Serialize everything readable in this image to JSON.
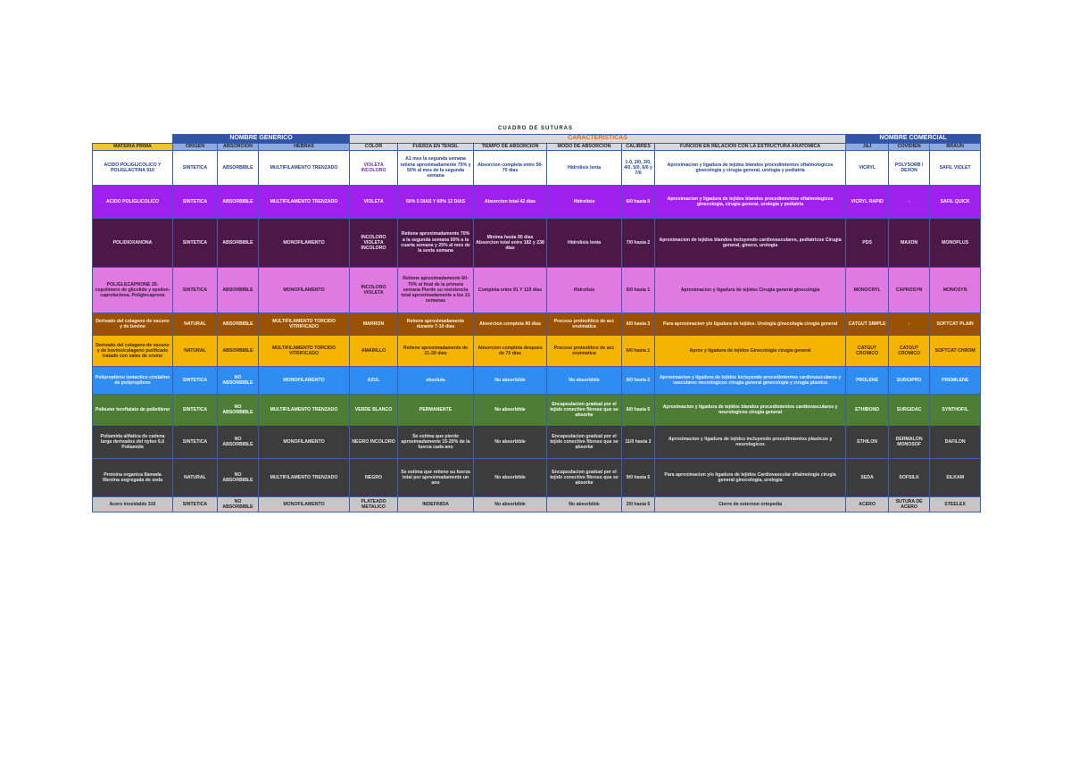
{
  "title": "CUADRO DE SUTURAS",
  "groups": {
    "generic": "NOMBRE GENERICO",
    "caract": "CARACTERISTICAS",
    "comercial": "NOMBRE COMERCIAL"
  },
  "headers": [
    "MATERIA PRIMA",
    "ORIGEN",
    "ABSORCION",
    "HEBRAS",
    "COLOR",
    "FUERZA EN TENSIL",
    "TIEMPO DE ABSORCION",
    "MODO DE ABSORCION",
    "CALIBRES",
    "FUNCION EN RELACION CON LA ESTRUCTURA ANATOMICA",
    "J&J",
    "COVIDIEN",
    "BRAUN"
  ],
  "colors": {
    "blue_header": "#3254a6",
    "orange_text": "#e26b10",
    "materia_header": "#f4c430"
  },
  "rows": [
    [
      "ACIDO POLIGLICOLICO Y POLIGLACTINA 910",
      "SINTETICA",
      "ABSORBIBLE",
      "MULTIFILAMENTO TRENZADO",
      "VIOLETA INCOLORO",
      "A1 mes la segunda semana retiene aproximadamente 75% y 50% al mes de la segunda semana",
      "Absorcion completa entre 56-70 dias",
      "Hidrolisis lenta",
      "1-0, 2/0, 3/0, 4/0, 5/0, 6/0 y 7/0",
      "Aproximacion y ligadura de tejidos blandos procedimientos oftalmologicos ginecologia y cirugia general, urologia y pediatria",
      "VICRYL",
      "POLYSORB / DEXON",
      "SAFIL VIOLET"
    ],
    [
      "ACIDO POLIGLICOLICO",
      "SINTETICA",
      "ABSORBIBLE",
      "MULTIFILAMENTO TRENZADO",
      "VIOLETA",
      "50% 5 DIAS Y 60% 12 DIAS",
      "Absorcion total 42 dias",
      "Hidrolisis",
      "6/0 hasta 0",
      "Aproximacion y ligadura de tejidos blandos procedimientos oftalmologicos ginecologia, cirugia general, urologia y pediatria",
      "VICRYL RAPID",
      "-",
      "SAFIL QUICK"
    ],
    [
      "POLIDIOXANONA",
      "SINTETICA",
      "ABSORBIBLE",
      "MONOFILAMENTO",
      "INCOLORO VIOLETA INCOLORO",
      "Retiene aproximadamente 70% a la segunda semana 50% a la cuarta semana y 25% al mes de la sexta semana",
      "Minima hasta 90 dias Absorcion total entre 182 y 238 dias",
      "Hidrolisis lenta",
      "7/0 hasta 2",
      "Aproximacion de tejidos blandos incluyendo cardiovasculares, pediatricos Cirugia general, gineco, urologia",
      "PDS",
      "MAXON",
      "MONOPLUS"
    ],
    [
      "POLIGLECAPRONE 25- copolimero de glicolido y epsilon-caprolactona. Poliglecaprone",
      "SINTETICA",
      "ABSORBIBLE",
      "MONOFILAMENTO",
      "INCOLORO VIOLETA",
      "Retiene aproximadamente 60-70% al final de la primera semana Pierde su resistencia total aproximadamente a los 21 semanas",
      "Completa entre 91 Y 119 dias",
      "Hidrolisis",
      "6/0 hasta 1",
      "Aproximacion y ligadura de tejidos Cirugia general ginecologia",
      "MONOCRYL",
      "CAPROSYN",
      "MONOSYN"
    ],
    [
      "Derivado del colageno de vacuno y de bovino",
      "NATURAL",
      "ABSORBIBLE",
      "MULTIFILAMENTO TORCIDO VITRIFICADO",
      "MARRON",
      "Retiene aproximadamente durante 7-10 dias",
      "Absorcion completa 90 dias",
      "Proceso proteolitico de acc enzimatica",
      "6/0 hasta 2",
      "Para aproximacion y/o ligadura de tejidos. Urologia ginecologia cirugia general",
      "CATGUT SIMPLE",
      "-",
      "SOFTCAT PLAIN"
    ],
    [
      "Derivado del colageno de vacuno y de bovino/colageno purificado tratado con sales de cromo",
      "NATURAL",
      "ABSORBIBLE",
      "MULTIFILAMENTO TORCIDO VITRIFICADO",
      "AMARILLO",
      "Retiene aproximadamente de 21-28 dias",
      "Absorcion completa despues de 70 dias",
      "Proceso proteolitico de acc enzimatica",
      "6/0 hasta 1",
      "Aprox y ligadura de tejidos Ginecologia cirugia general",
      "CATGUT CROMICO",
      "CATGUT CROMICO",
      "SOFTCAT CHROM"
    ],
    [
      "Polipropileno isotactico cristalino de polipropileno",
      "SINTETICA",
      "NO ABSORBIBLE",
      "MONOFILAMENTO",
      "AZUL",
      "absoluta",
      "No absorbible",
      "No absorbible",
      "8/0 hasta 2",
      "Aproximacion y ligadura de tejidos incluyendo procedimientos cardiovasculares y vasculares neurologicos cirugia general ginecologia y cirugia plastica",
      "PROLENE",
      "SURGIPRO",
      "PREMILENE"
    ],
    [
      "Poliester tereftalato de polietileno",
      "SINTETICA",
      "NO ABSORBIBLE",
      "MULTIFILAMENTO TRENZADO",
      "VERDE BLANCO",
      "PERMANENTE",
      "No absorbible",
      "Encapsulacion gradual por el tejido conectivo fibroso que se absorbe",
      "6/0 hasta 5",
      "Aproximacion y ligadura de tejidos blandos procedimientos cardiovasculares y neurologicos cirugia general",
      "ETHIBOND",
      "SURGIDAC",
      "SYNTHOFIL"
    ],
    [
      "Poliamida alifatica de cadena larga derivados del nylon 6,6 Poliamida",
      "SINTETICA",
      "NO ABSORBIBLE",
      "MONOFILAMENTO",
      "NEGRO INCOLORO",
      "Se estima que pierde aproximadamente 15-20% de la fuerza cada ano",
      "No absorbible",
      "Encapsulacion gradual por el tejido conectivo fibroso que se absorbe",
      "11/0 hasta 2",
      "Aproximacion y ligadura de tejidos incluyendo procedimientos plasticos y neurologicos",
      "ETHILON",
      "DERMALON MONOSOF",
      "DAFILON"
    ],
    [
      "Proteina organica llamada fibroina segregada de seda",
      "NATURAL",
      "NO ABSORBIBLE",
      "MULTIFILAMENTO TRENZADO",
      "NEGRO",
      "Se estima que retiene su fuerza total por aproximadamente un ano",
      "No absorbible",
      "Encapsulacion gradual por el tejido conectivo fibroso que se absorbe",
      "9/0 hasta 5",
      "Para aproximacion y/o ligadura de tejidos Cardiovascular oftalmologia cirugia general ginecologia, urologia",
      "SEDA",
      "SOFSILK",
      "SILKAM"
    ],
    [
      "Acero inoxidable 316",
      "SINTETICA",
      "NO ABSORBIBLE",
      "MONOFILAMENTO",
      "PLATEADO METALICO",
      "INDEFINIDA",
      "No absorbible",
      "No absorbible",
      "2/0 hasta 5",
      "Cierre de esternon ortopedia",
      "ACERO",
      "SUTURA DE ACERO",
      "STEELEX"
    ]
  ]
}
